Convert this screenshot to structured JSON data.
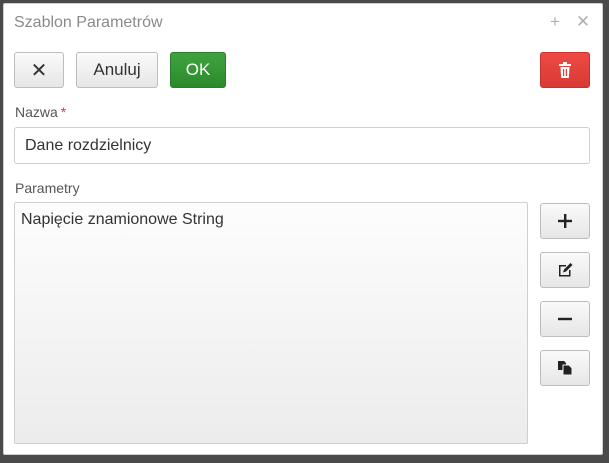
{
  "window": {
    "title": "Szablon Parametrów",
    "maximize_glyph": "+",
    "close_glyph": "✕"
  },
  "toolbar": {
    "close_glyph": "✕",
    "cancel_label": "Anuluj",
    "ok_label": "OK",
    "ok_color": "#2f962f",
    "delete_color": "#e0423b"
  },
  "form": {
    "name_label": "Nazwa",
    "required_marker": "*",
    "name_value": "Dane rozdzielnicy",
    "params_label": "Parametry",
    "params": [
      {
        "label": "Napięcie znamionowe String"
      }
    ]
  },
  "side_buttons": {
    "add_glyph": "+",
    "remove_glyph": "−",
    "icons": [
      "plus-icon",
      "edit-icon",
      "minus-icon",
      "copy-icon"
    ]
  }
}
